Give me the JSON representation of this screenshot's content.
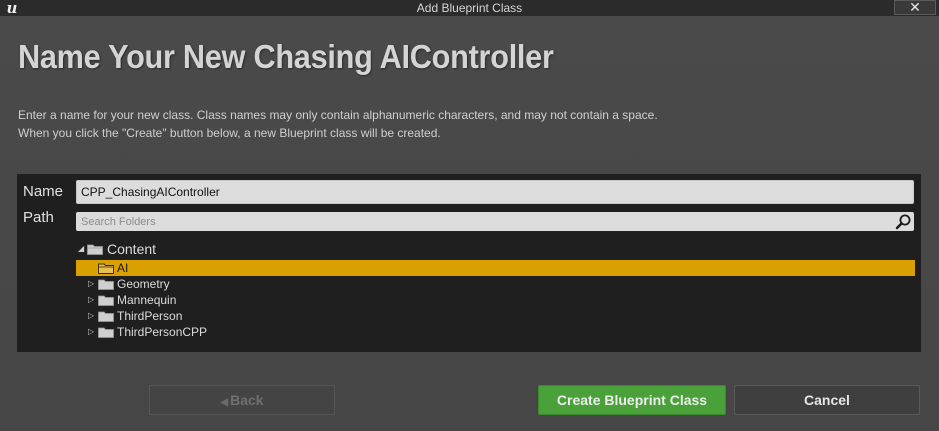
{
  "window": {
    "title": "Add Blueprint Class",
    "logo_text": "u",
    "close_label": "✕"
  },
  "header": {
    "headline": "Name Your New Chasing AIController",
    "description_line1": "Enter a name for your new class. Class names may only contain alphanumeric characters, and may not contain a space.",
    "description_line2": "When you click the \"Create\" button below, a new Blueprint class will be created."
  },
  "form": {
    "name_label": "Name",
    "name_value": "CPP_ChasingAIController",
    "path_label": "Path",
    "search_placeholder": "Search Folders"
  },
  "tree": {
    "root_label": "Content",
    "items": [
      {
        "label": "AI",
        "selected": true,
        "has_children": false
      },
      {
        "label": "Geometry",
        "selected": false,
        "has_children": true
      },
      {
        "label": "Mannequin",
        "selected": false,
        "has_children": true
      },
      {
        "label": "ThirdPerson",
        "selected": false,
        "has_children": true
      },
      {
        "label": "ThirdPersonCPP",
        "selected": false,
        "has_children": true
      }
    ]
  },
  "buttons": {
    "back_label": "Back",
    "create_label": "Create Blueprint Class",
    "cancel_label": "Cancel"
  },
  "colors": {
    "accent_selection": "#d9a000",
    "create_button": "#4aa13a",
    "background": "#454545",
    "panel": "#1f1f1f"
  },
  "icons": {
    "logo": "unreal-logo-icon",
    "close": "close-icon",
    "search": "search-icon",
    "folder": "folder-icon",
    "expander_collapsed": "triangle-right-icon",
    "expander_expanded": "triangle-down-icon",
    "back_arrow": "arrow-left-icon"
  }
}
